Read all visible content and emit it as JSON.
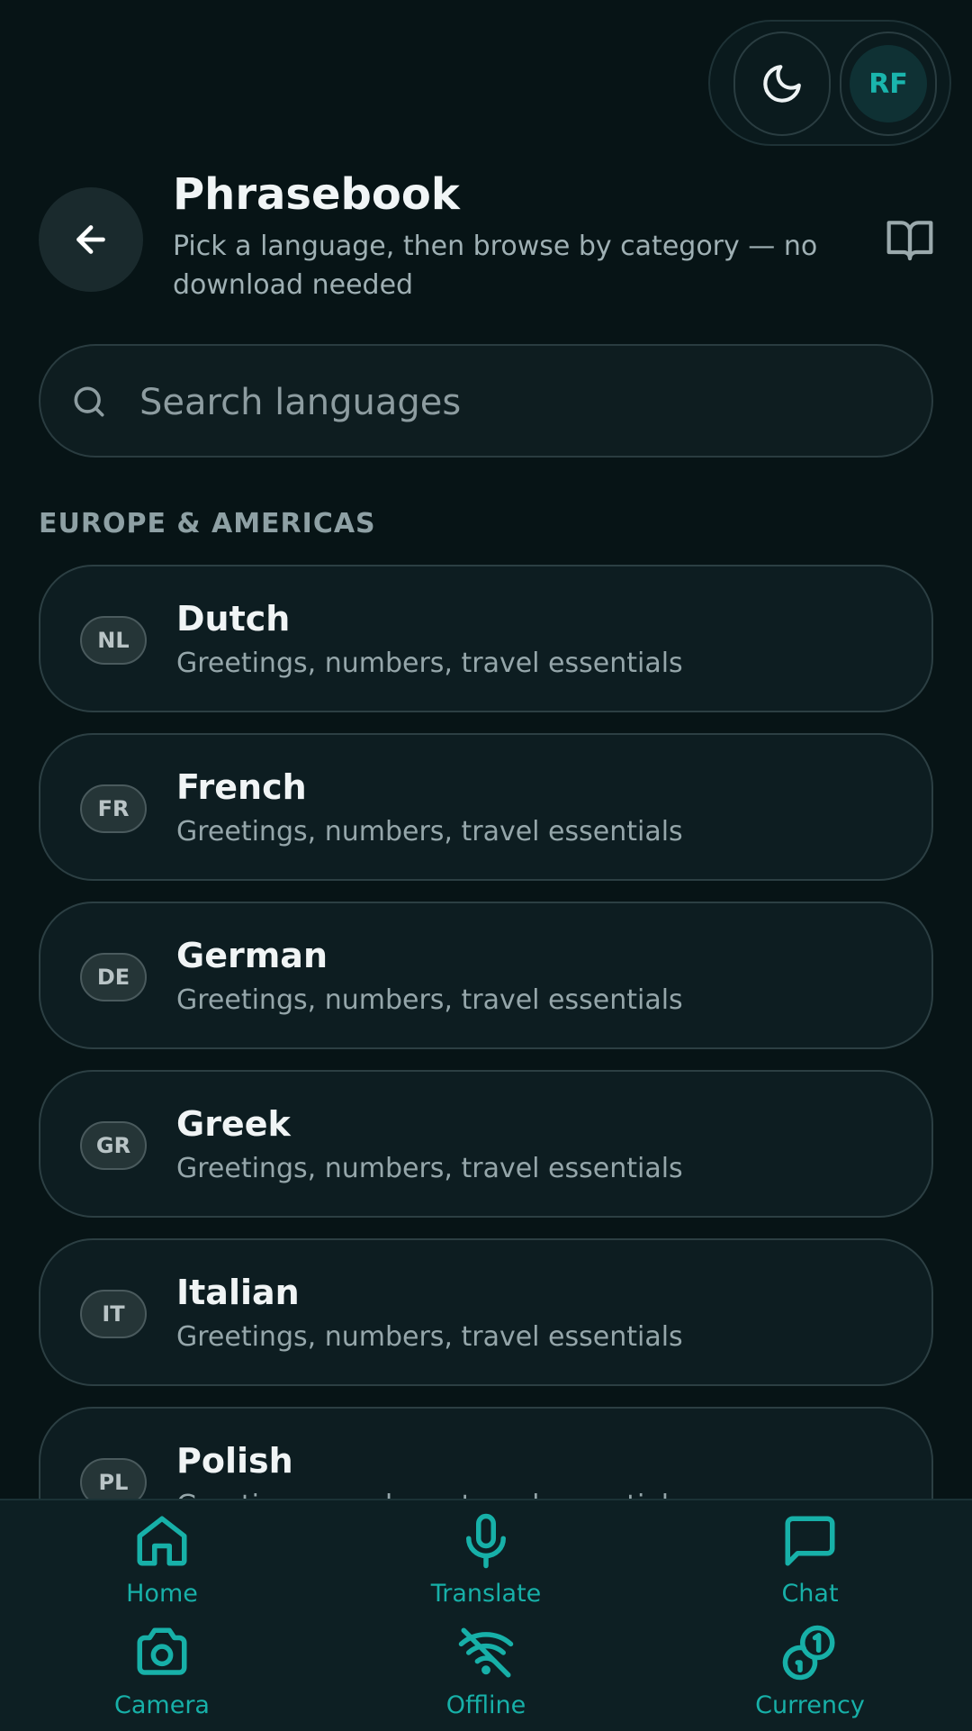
{
  "header": {
    "title": "Phrasebook",
    "subtitle": "Pick a language, then browse by category — no download needed",
    "avatar_initials": "RF"
  },
  "search": {
    "placeholder": "Search languages"
  },
  "section": {
    "label": "EUROPE & AMERICAS"
  },
  "languages": [
    {
      "code": "NL",
      "name": "Dutch",
      "desc": "Greetings, numbers, travel essentials"
    },
    {
      "code": "FR",
      "name": "French",
      "desc": "Greetings, numbers, travel essentials"
    },
    {
      "code": "DE",
      "name": "German",
      "desc": "Greetings, numbers, travel essentials"
    },
    {
      "code": "GR",
      "name": "Greek",
      "desc": "Greetings, numbers, travel essentials"
    },
    {
      "code": "IT",
      "name": "Italian",
      "desc": "Greetings, numbers, travel essentials"
    },
    {
      "code": "PL",
      "name": "Polish",
      "desc": "Greetings, numbers, travel essentials"
    }
  ],
  "nav": {
    "home": "Home",
    "translate": "Translate",
    "chat": "Chat",
    "camera": "Camera",
    "offline": "Offline",
    "currency": "Currency"
  },
  "colors": {
    "accent": "#17b0a8",
    "background": "#071416",
    "card": "#0d1d21"
  }
}
